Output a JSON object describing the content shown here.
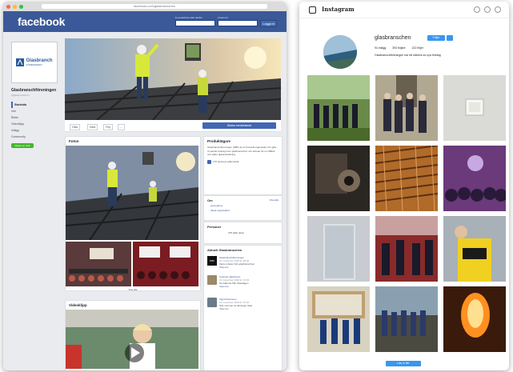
{
  "facebook": {
    "window": {
      "url": "facebook.com/glasbranschen"
    },
    "header": {
      "logo": "facebook",
      "email_label": "E-postadress eller telefon",
      "password_label": "Lösenord",
      "login_button": "Logga in"
    },
    "sidebar": {
      "profile_logo": "Glasbranch",
      "profile_logo_sub": "FÖRENINGEN",
      "page_name": "Glasbranschföreningen",
      "handle": "@glasbranschen",
      "items": [
        {
          "label": "Startsida",
          "active": true
        },
        {
          "label": "Info"
        },
        {
          "label": "Bilder"
        },
        {
          "label": "Videoklipp"
        },
        {
          "label": "Inlägg"
        },
        {
          "label": "Community"
        }
      ],
      "create_button": "Skapa en sida"
    },
    "actions": {
      "like": "Gilla",
      "share": "Dela",
      "follow": "Följ",
      "more": "...",
      "send_button": "Skicka meddelande"
    },
    "photos_card": {
      "title": "Foton",
      "see_all": "Visa alla"
    },
    "videos_card": {
      "title": "Videoklipp"
    },
    "info_card": {
      "title": "Produktägare",
      "text": "Glasbranschföreningen (GBF) är en branschorganisation för glas. Vi samlar företag inom glasbranschen och arbetar för en hållbar och säker glasanvändning.",
      "community": "176 personer gillar detta",
      "about_title": "Om",
      "about_link": "Visa alla",
      "website": "www.gbf.se",
      "category": "Ideell organisation"
    },
    "people_card": {
      "title": "Personer",
      "count": "378 gillar detta"
    },
    "posts_card": {
      "title": "Aktuell Glasbranschen",
      "items": [
        {
          "source": "Glasbranschföreningen",
          "time": "21 november 2018 kl. 08:00",
          "text": "Flera nyheter från glasbranschen",
          "more": "Visa mer"
        },
        {
          "source": "Andreas Jakobsson",
          "time": "19 november 2018 kl. 16:45",
          "text": "Se bilderna från Glasdagen",
          "more": "Visa mer"
        },
        {
          "source": "Ingrid Svensson",
          "time": "15 november 2018 kl. 10:20",
          "text": "Nytt nummer av tidningen Glas",
          "more": "Visa mer"
        }
      ]
    }
  },
  "instagram": {
    "header": {
      "logo": "Instagram"
    },
    "profile": {
      "username": "glasbranschen",
      "follow_button": "Följer",
      "posts": "94 inlägg",
      "followers": "393 följare",
      "following": "222 följer",
      "bio": "Glasbranschföreningen har ett nätverk av nya företag"
    },
    "grid_icons": [
      "group-photo",
      "group-photo",
      "glass-box",
      "machinery",
      "glass-facade",
      "event-crowd",
      "glass-wall",
      "event-hall",
      "yellow-shirt-worker",
      "booth",
      "team-outside",
      "glow-furnace"
    ],
    "load_more": "Läs in fler"
  },
  "colors": {
    "fb_blue": "#3b5998",
    "fb_button": "#4267b2",
    "ig_blue": "#3897f0",
    "create_green": "#42b72a"
  }
}
